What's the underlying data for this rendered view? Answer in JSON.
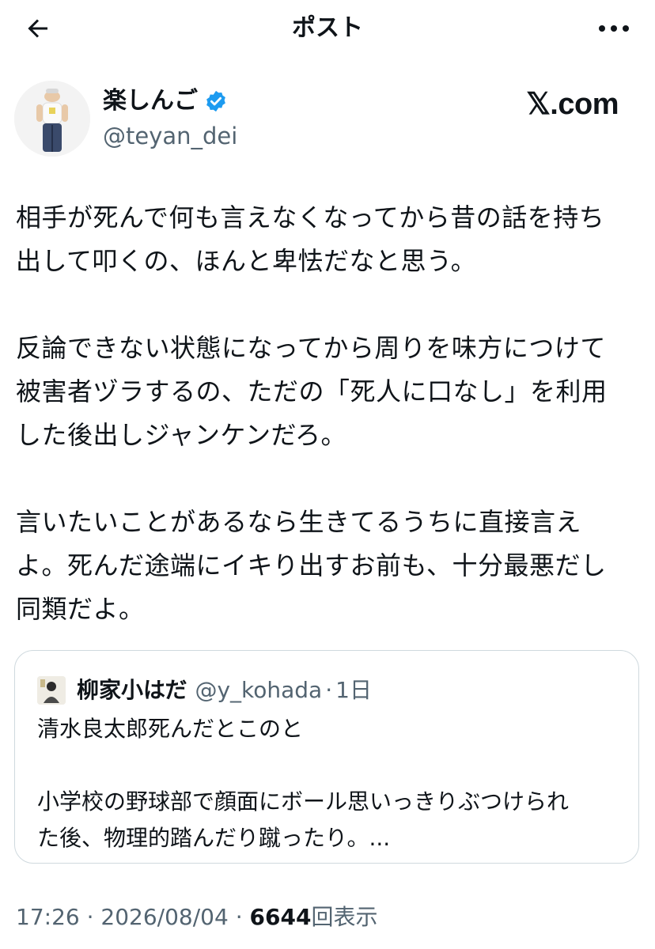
{
  "topbar": {
    "title": "ポスト",
    "back_icon": "arrow-left-icon",
    "more_icon": "more-horizontal-icon"
  },
  "author": {
    "display_name": "楽しんご",
    "handle": "@teyan_dei",
    "verified": true,
    "verified_color": "#1d9bf0",
    "watermark": "𝕏.com"
  },
  "post": {
    "paragraphs": [
      [
        "相手が死んで何も言えなくなってから昔の話を持ち",
        "出して叩くの、ほんと卑怯だなと思う。"
      ],
      [
        "反論できない状態になってから周りを味方につけて",
        "被害者ヅラするの、ただの「死人に口なし」を利用",
        "した後出しジャンケンだろ。"
      ],
      [
        "言いたいことがあるなら生きてるうちに直接言え",
        "よ。死んだ途端にイキり出すお前も、十分最悪だし",
        "同類だよ。"
      ]
    ]
  },
  "quote": {
    "display_name": "柳家小はだ",
    "handle": "@y_kohada",
    "dot": "·",
    "time": "1日",
    "paragraphs": [
      [
        "清水良太郎死んだとこのと"
      ],
      [
        "小学校の野球部で顔面にボール思いっきりぶつけられ",
        "た後、物理的踏んだり蹴ったり。..."
      ]
    ]
  },
  "meta": {
    "time": "17:26",
    "sep1": " · ",
    "date": "2026/08/04",
    "sep2": " · ",
    "views_count": "6644",
    "views_label": "回表示"
  },
  "colors": {
    "text": "#0f1419",
    "secondary": "#536471",
    "border": "#cfd9de"
  }
}
